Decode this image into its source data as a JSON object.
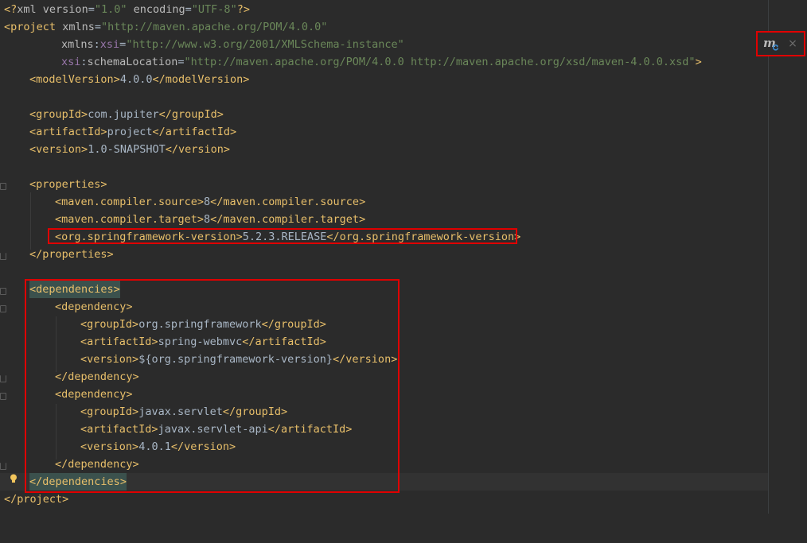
{
  "editor": {
    "file_content": [
      "<?xml version=\"1.0\" encoding=\"UTF-8\"?>",
      "<project xmlns=\"http://maven.apache.org/POM/4.0.0\"",
      "xmlns:xsi=\"http://www.w3.org/2001/XMLSchema-instance\"",
      "xsi:schemaLocation=\"http://maven.apache.org/POM/4.0.0 http://maven.apache.org/xsd/maven-4.0.0.xsd\">",
      "<modelVersion>4.0.0</modelVersion>",
      "<groupId>com.jupiter</groupId>",
      "<artifactId>project</artifactId>",
      "<version>1.0-SNAPSHOT</version>",
      "<properties>",
      "<maven.compiler.source>8</maven.compiler.source>",
      "<maven.compiler.target>8</maven.compiler.target>",
      "<org.springframework-version>5.2.3.RELEASE</org.springframework-version>",
      "</properties>",
      "<dependencies>",
      "<dependency>",
      "<groupId>org.springframework</groupId>",
      "<artifactId>spring-webmvc</artifactId>",
      "<version>${org.springframework-version}</version>",
      "</dependency>",
      "<dependency>",
      "<groupId>javax.servlet</groupId>",
      "<artifactId>javax.servlet-api</artifactId>",
      "<version>4.0.1</version>",
      "</dependency>",
      "</dependencies>",
      "</project>"
    ]
  },
  "maven_widget": {
    "icon": "maven-reload-icon",
    "icon_glyph": "m",
    "close_glyph": "×"
  },
  "colors": {
    "background": "#2b2b2b",
    "tag": "#e8bf6a",
    "string": "#6a8759",
    "text": "#a9b7c6",
    "highlight": "#e00000"
  }
}
